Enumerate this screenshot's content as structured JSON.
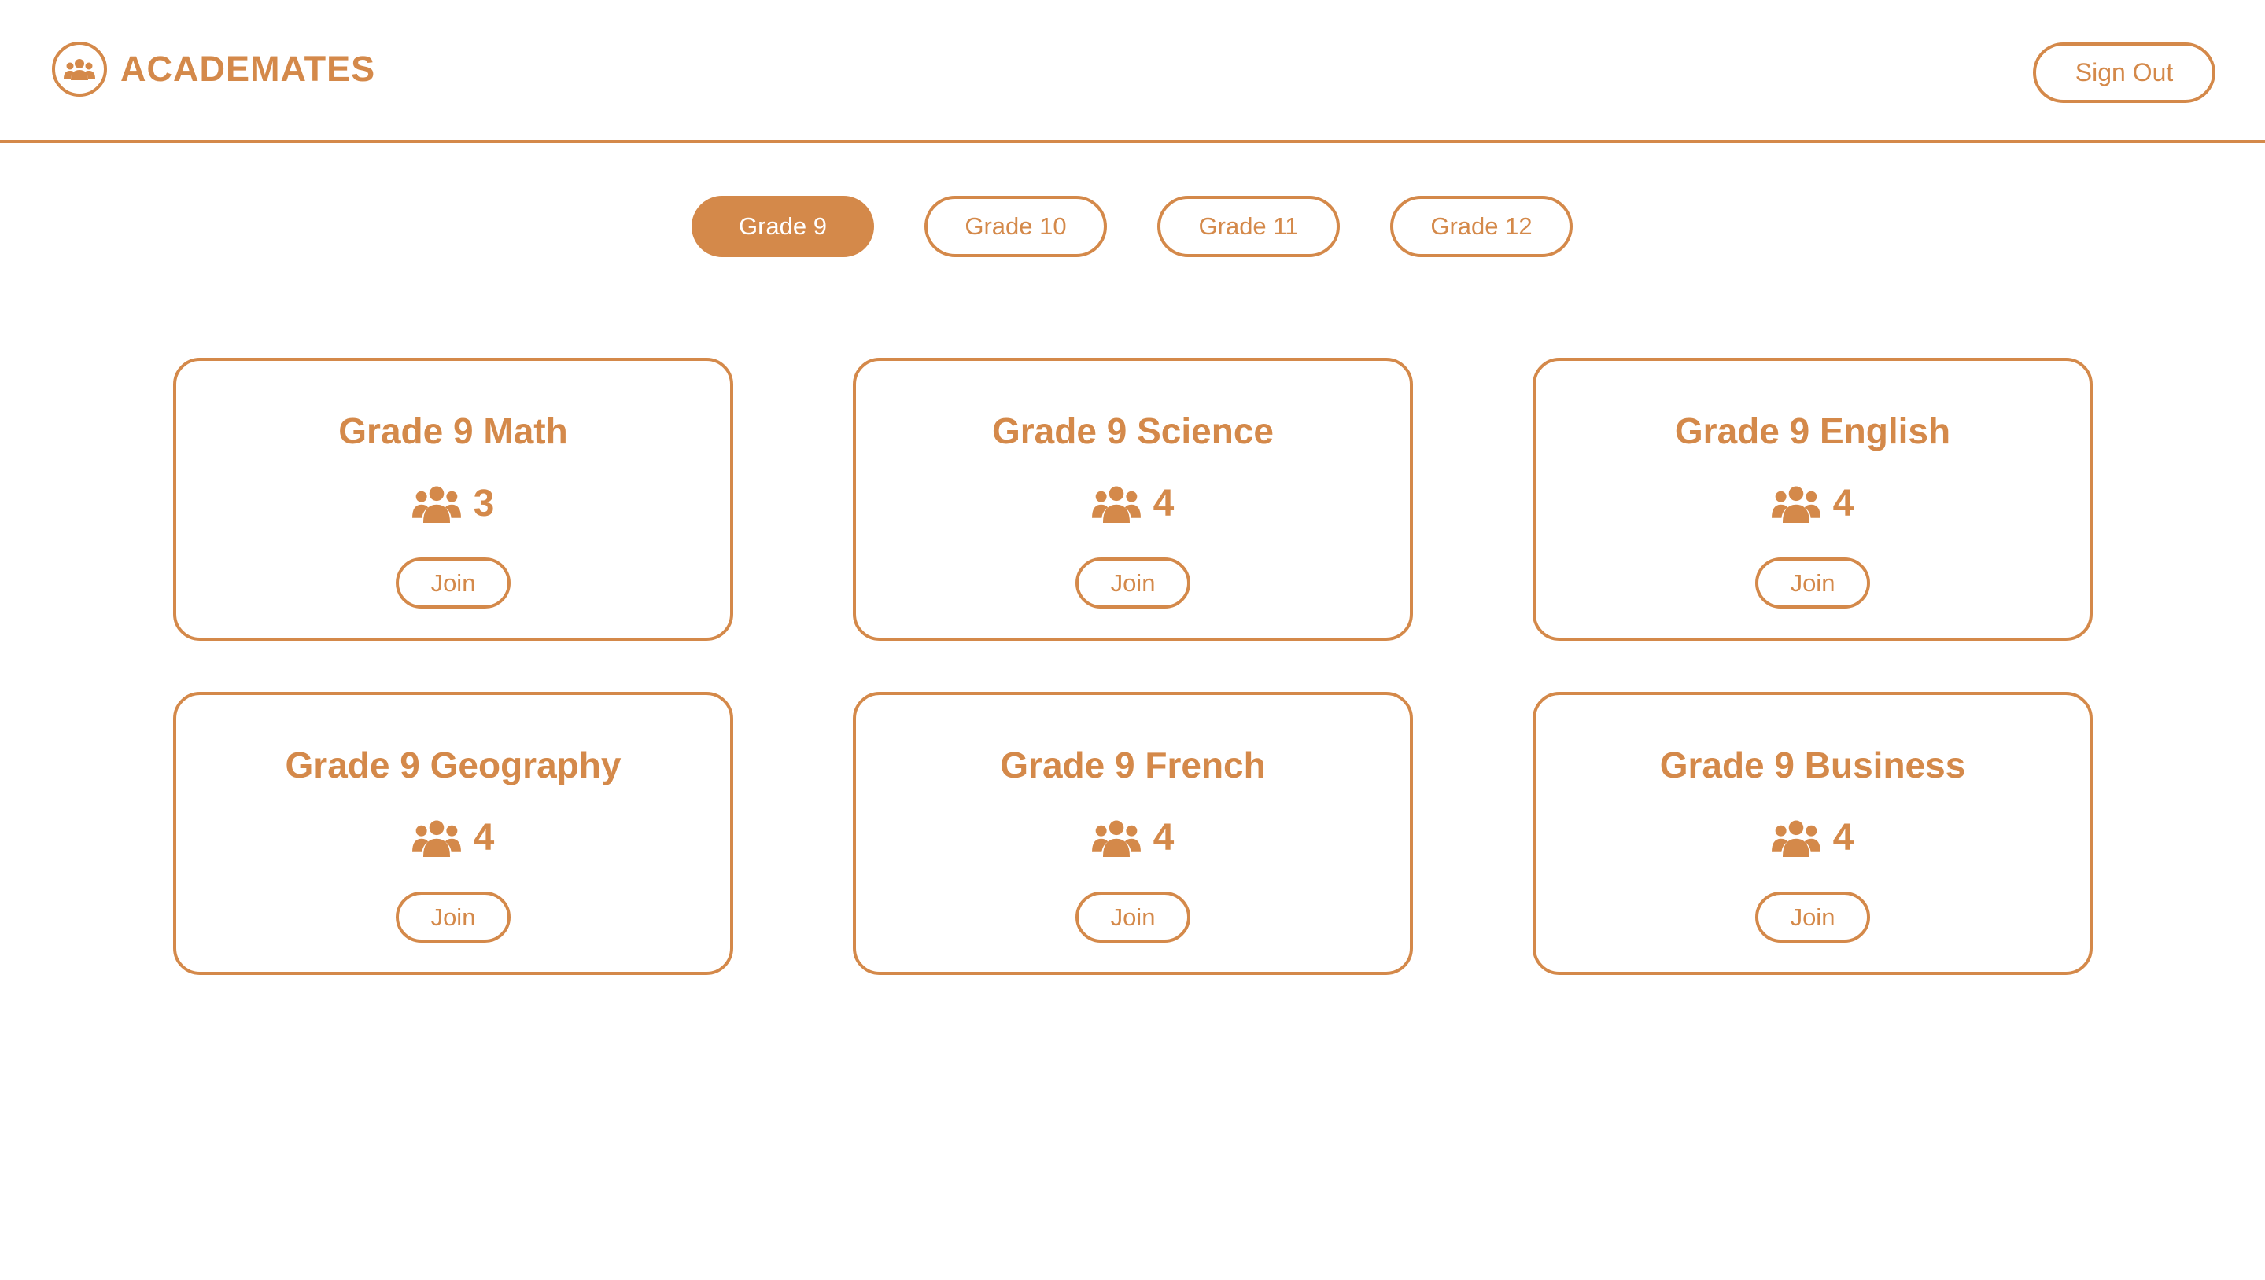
{
  "app": {
    "name": "ACADEMATES",
    "logo_icon": "group-icon"
  },
  "header": {
    "signout_label": "Sign Out"
  },
  "tabs": [
    {
      "label": "Grade 9",
      "active": true
    },
    {
      "label": "Grade 10",
      "active": false
    },
    {
      "label": "Grade 11",
      "active": false
    },
    {
      "label": "Grade 12",
      "active": false
    }
  ],
  "groups": [
    {
      "title": "Grade 9 Math",
      "members": "3",
      "join_label": "Join"
    },
    {
      "title": "Grade 9 Science",
      "members": "4",
      "join_label": "Join"
    },
    {
      "title": "Grade 9 English",
      "members": "4",
      "join_label": "Join"
    },
    {
      "title": "Grade 9 Geography",
      "members": "4",
      "join_label": "Join"
    },
    {
      "title": "Grade 9 French",
      "members": "4",
      "join_label": "Join"
    },
    {
      "title": "Grade 9 Business",
      "members": "4",
      "join_label": "Join"
    }
  ],
  "colors": {
    "accent": "#D4894A",
    "background": "#FFFFFF",
    "active_tab_text": "#FFFFFF"
  }
}
